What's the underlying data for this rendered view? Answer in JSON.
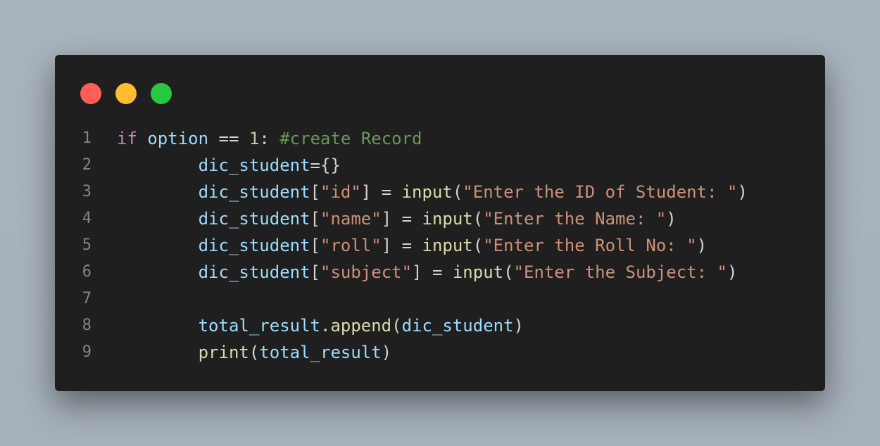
{
  "window": {
    "controls": [
      {
        "name": "close",
        "color": "#ff5f57"
      },
      {
        "name": "minimize",
        "color": "#febc2e"
      },
      {
        "name": "maximize",
        "color": "#28c840"
      }
    ]
  },
  "colors": {
    "keyword": "#c586c0",
    "variable": "#9cdcfe",
    "number": "#b5cea8",
    "comment": "#6a9955",
    "string": "#ce9178",
    "function": "#dcdcaa",
    "plain": "#d4d4d4",
    "line_number": "#858585"
  },
  "code": {
    "lines": [
      {
        "number": "1",
        "tokens": [
          {
            "t": "if",
            "c": "kw"
          },
          {
            "t": " ",
            "c": "pun"
          },
          {
            "t": "option",
            "c": "var"
          },
          {
            "t": " == ",
            "c": "op"
          },
          {
            "t": "1",
            "c": "num"
          },
          {
            "t": ": ",
            "c": "pun"
          },
          {
            "t": "#create Record",
            "c": "cmt"
          }
        ]
      },
      {
        "number": "2",
        "tokens": [
          {
            "t": "        ",
            "c": "pun"
          },
          {
            "t": "dic_student",
            "c": "var"
          },
          {
            "t": "={}",
            "c": "pun"
          }
        ]
      },
      {
        "number": "3",
        "tokens": [
          {
            "t": "        ",
            "c": "pun"
          },
          {
            "t": "dic_student",
            "c": "var"
          },
          {
            "t": "[",
            "c": "pun"
          },
          {
            "t": "\"id\"",
            "c": "str"
          },
          {
            "t": "] = ",
            "c": "pun"
          },
          {
            "t": "input",
            "c": "fn"
          },
          {
            "t": "(",
            "c": "pun"
          },
          {
            "t": "\"Enter the ID of Student: \"",
            "c": "str"
          },
          {
            "t": ")",
            "c": "pun"
          }
        ]
      },
      {
        "number": "4",
        "tokens": [
          {
            "t": "        ",
            "c": "pun"
          },
          {
            "t": "dic_student",
            "c": "var"
          },
          {
            "t": "[",
            "c": "pun"
          },
          {
            "t": "\"name\"",
            "c": "str"
          },
          {
            "t": "] = ",
            "c": "pun"
          },
          {
            "t": "input",
            "c": "fn"
          },
          {
            "t": "(",
            "c": "pun"
          },
          {
            "t": "\"Enter the Name: \"",
            "c": "str"
          },
          {
            "t": ")",
            "c": "pun"
          }
        ]
      },
      {
        "number": "5",
        "tokens": [
          {
            "t": "        ",
            "c": "pun"
          },
          {
            "t": "dic_student",
            "c": "var"
          },
          {
            "t": "[",
            "c": "pun"
          },
          {
            "t": "\"roll\"",
            "c": "str"
          },
          {
            "t": "] = ",
            "c": "pun"
          },
          {
            "t": "input",
            "c": "fn"
          },
          {
            "t": "(",
            "c": "pun"
          },
          {
            "t": "\"Enter the Roll No: \"",
            "c": "str"
          },
          {
            "t": ")",
            "c": "pun"
          }
        ]
      },
      {
        "number": "6",
        "tokens": [
          {
            "t": "        ",
            "c": "pun"
          },
          {
            "t": "dic_student",
            "c": "var"
          },
          {
            "t": "[",
            "c": "pun"
          },
          {
            "t": "\"subject\"",
            "c": "str"
          },
          {
            "t": "] = ",
            "c": "pun"
          },
          {
            "t": "input",
            "c": "fn"
          },
          {
            "t": "(",
            "c": "pun"
          },
          {
            "t": "\"Enter the Subject: \"",
            "c": "str"
          },
          {
            "t": ")",
            "c": "pun"
          }
        ]
      },
      {
        "number": "7",
        "tokens": []
      },
      {
        "number": "8",
        "tokens": [
          {
            "t": "        ",
            "c": "pun"
          },
          {
            "t": "total_result",
            "c": "var"
          },
          {
            "t": ".",
            "c": "pun"
          },
          {
            "t": "append",
            "c": "fn"
          },
          {
            "t": "(",
            "c": "pun"
          },
          {
            "t": "dic_student",
            "c": "var"
          },
          {
            "t": ")",
            "c": "pun"
          }
        ]
      },
      {
        "number": "9",
        "tokens": [
          {
            "t": "        ",
            "c": "pun"
          },
          {
            "t": "print",
            "c": "fn"
          },
          {
            "t": "(",
            "c": "pun"
          },
          {
            "t": "total_result",
            "c": "var"
          },
          {
            "t": ")",
            "c": "pun"
          }
        ]
      }
    ]
  }
}
